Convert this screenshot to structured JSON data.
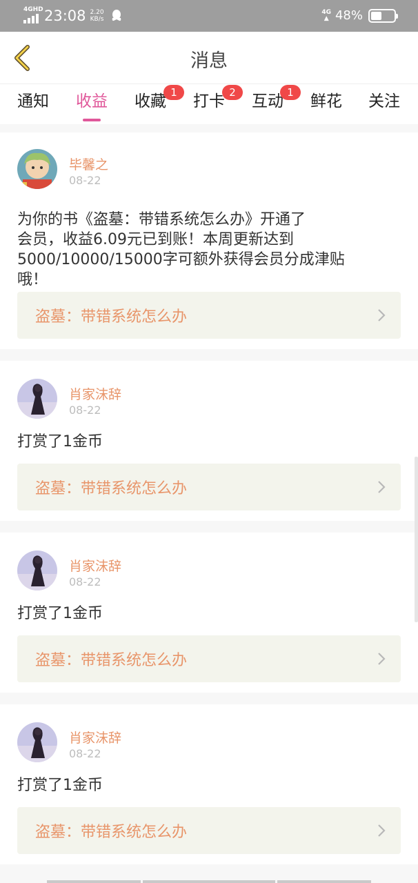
{
  "status_bar": {
    "network": "4GHD",
    "time": "23:08",
    "speed_value": "2.20",
    "speed_unit": "KB/s",
    "network_right": "4G",
    "battery": "48%",
    "battery_level": 0.48
  },
  "header": {
    "title": "消息",
    "back_icon": "chevron-left-icon"
  },
  "tabs": [
    {
      "label": "通知",
      "badge": null,
      "active": false
    },
    {
      "label": "收益",
      "badge": null,
      "active": true
    },
    {
      "label": "收藏",
      "badge": "1",
      "active": false
    },
    {
      "label": "打卡",
      "badge": "2",
      "active": false
    },
    {
      "label": "互动",
      "badge": "1",
      "active": false
    },
    {
      "label": "鲜花",
      "badge": null,
      "active": false
    },
    {
      "label": "关注",
      "badge": null,
      "active": false
    }
  ],
  "messages": [
    {
      "name": "毕馨之",
      "date": "08-22",
      "text_lines": [
        "为你的书《盗墓：带错系统怎么办》开通了",
        "会员，收益6.09元已到账！本周更新达到",
        "5000/10000/15000字可额外获得会员分成津贴",
        "哦！"
      ],
      "book": "盗墓：带错系统怎么办"
    },
    {
      "name": "肖家沫辞",
      "date": "08-22",
      "text_lines": [
        "打赏了1金币"
      ],
      "book": "盗墓：带错系统怎么办"
    },
    {
      "name": "肖家沫辞",
      "date": "08-22",
      "text_lines": [
        "打赏了1金币"
      ],
      "book": "盗墓：带错系统怎么办"
    },
    {
      "name": "肖家沫辞",
      "date": "08-22",
      "text_lines": [
        "打赏了1金币"
      ],
      "book": "盗墓：带错系统怎么办"
    }
  ],
  "colors": {
    "accent_pink": "#e0579a",
    "name_orange": "#e8956a",
    "badge_red": "#f04848",
    "book_bg": "#f3f4ec"
  }
}
